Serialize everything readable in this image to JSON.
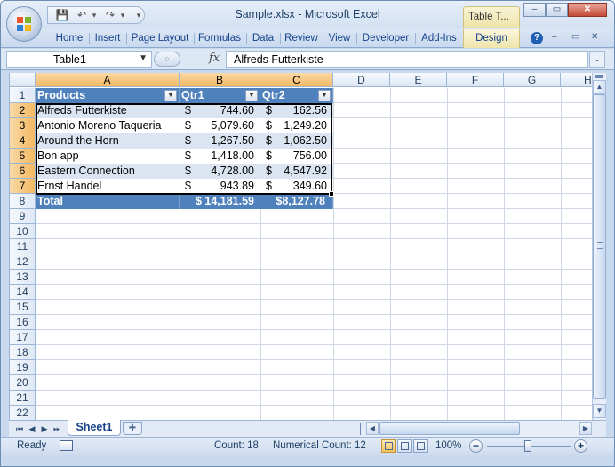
{
  "window": {
    "title": "Sample.xlsx - Microsoft Excel",
    "context_tab": "Table T...",
    "controls": {
      "minimize": "–",
      "restore": "▭",
      "close": "✕"
    }
  },
  "qat": {
    "save_icon": "💾",
    "undo_icon": "↶",
    "undo_drop": "▾",
    "redo_icon": "↷",
    "redo_drop": "▾",
    "customize": "▾"
  },
  "ribbon": {
    "tabs": [
      "Home",
      "Insert",
      "Page Layout",
      "Formulas",
      "Data",
      "Review",
      "View",
      "Developer",
      "Add-Ins"
    ],
    "context_tab": "Design",
    "help": "?",
    "minimize_ctl": "–",
    "restore_ctl": "▭",
    "close_ctl": "✕"
  },
  "formula_bar": {
    "name_box": "Table1",
    "name_arrow": "▼",
    "fx": "fx",
    "fx_round": "○",
    "content": "Alfreds Futterkiste",
    "expand": "⌄"
  },
  "grid": {
    "columns": [
      "A",
      "B",
      "C",
      "D",
      "E",
      "F",
      "G",
      "H"
    ],
    "rows": [
      "1",
      "2",
      "3",
      "4",
      "5",
      "6",
      "7",
      "8",
      "9",
      "10",
      "11",
      "12",
      "13",
      "14",
      "15",
      "16",
      "17",
      "18",
      "19",
      "20",
      "21",
      "22"
    ]
  },
  "table": {
    "headers": [
      "Products",
      "Qtr1",
      "Qtr2"
    ],
    "filter_glyph": "▼",
    "currency": "$",
    "rows": [
      {
        "product": "Alfreds Futterkiste",
        "qtr1": "744.60",
        "qtr2": "162.56"
      },
      {
        "product": "Antonio Moreno Taqueria",
        "qtr1": "5,079.60",
        "qtr2": "1,249.20"
      },
      {
        "product": "Around the Horn",
        "qtr1": "1,267.50",
        "qtr2": "1,062.50"
      },
      {
        "product": "Bon app",
        "qtr1": "1,418.00",
        "qtr2": "756.00"
      },
      {
        "product": "Eastern Connection",
        "qtr1": "4,728.00",
        "qtr2": "4,547.92"
      },
      {
        "product": "Ernst Handel",
        "qtr1": "943.89",
        "qtr2": "349.60"
      }
    ],
    "total": {
      "label": "Total",
      "qtr1": "$ 14,181.59",
      "qtr2": "$8,127.78"
    }
  },
  "sheets": {
    "nav": [
      "⏮",
      "◀",
      "▶",
      "⏭"
    ],
    "active": "Sheet1",
    "new_sheet_icon": "✚"
  },
  "status": {
    "ready": "Ready",
    "count": "Count: 18",
    "numerical_count": "Numerical Count: 12",
    "zoom": "100%",
    "zoom_out": "−",
    "zoom_in": "+"
  },
  "scroll_arrows": {
    "up": "▲",
    "down": "▼",
    "left": "◀",
    "right": "▶"
  },
  "colors": {
    "table_header": "#4f81bd",
    "band": "#dbe5f1",
    "selected_header": "#f3b962"
  }
}
